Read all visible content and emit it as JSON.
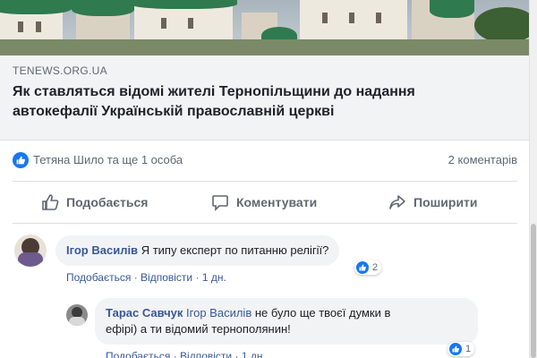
{
  "link": {
    "domain": "TENEWS.ORG.UA",
    "title_line1": "Як ставляться відомі жителі Тернопільщини до надання",
    "title_line2": "автокефалії Українській православній церкві"
  },
  "reactions": {
    "reactors": "Тетяна Шило та ще 1 особа",
    "comments_count": "2 коментарів"
  },
  "actions": {
    "like": "Подобається",
    "comment": "Коментувати",
    "share": "Поширити"
  },
  "comments": [
    {
      "author": "Ігор Василів",
      "text": "Я типу експерт по питанню релігії?",
      "like_label": "Подобається",
      "reply_label": "Відповісти",
      "time": "1 дн.",
      "reaction_count": "2"
    },
    {
      "author": "Тарас Савчук",
      "mention": "Ігор Василів",
      "text_line1": "не було ще твоєї думки в",
      "text_line2": "ефірі) а ти відомий тернополянин!",
      "like_label": "Подобається",
      "reply_label": "Відповісти",
      "time": "1 дн.",
      "reaction_count": "1"
    }
  ],
  "separator": "·",
  "colors": {
    "brand": "#1877f2",
    "link": "#385898",
    "muted": "#606770"
  }
}
